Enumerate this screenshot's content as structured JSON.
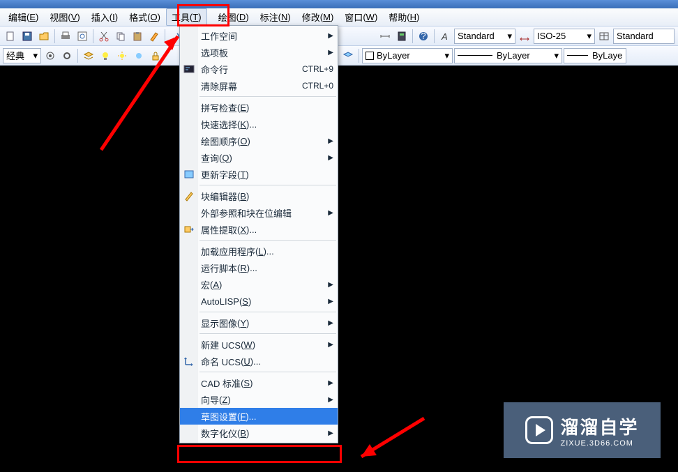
{
  "menubar": {
    "items": [
      {
        "label": "编辑",
        "key": "E"
      },
      {
        "label": "视图",
        "key": "V"
      },
      {
        "label": "插入",
        "key": "I"
      },
      {
        "label": "格式",
        "key": "O"
      },
      {
        "label": "工具",
        "key": "T"
      },
      {
        "label": "绘图",
        "key": "D"
      },
      {
        "label": "标注",
        "key": "N"
      },
      {
        "label": "修改",
        "key": "M"
      },
      {
        "label": "窗口",
        "key": "W"
      },
      {
        "label": "帮助",
        "key": "H"
      }
    ],
    "active_index": 4
  },
  "toolbar1": {
    "style_dropdown1": "Standard",
    "style_dropdown2": "ISO-25",
    "style_dropdown3": "Standard"
  },
  "toolbar2": {
    "workspace": "经典",
    "layer_dropdown": "ByLayer",
    "linetype_dropdown": "ByLayer",
    "lineweight_dropdown": "ByLaye"
  },
  "tools_menu": {
    "items": [
      {
        "label": "工作空间",
        "submenu": true
      },
      {
        "label": "选项板",
        "submenu": true
      },
      {
        "label": "命令行",
        "shortcut": "CTRL+9",
        "icon": "cmd"
      },
      {
        "label": "清除屏幕",
        "shortcut": "CTRL+0"
      },
      {
        "sep": true
      },
      {
        "label": "拼写检查",
        "key": "E"
      },
      {
        "label": "快速选择",
        "key": "K",
        "ellipsis": true
      },
      {
        "label": "绘图顺序",
        "key": "O",
        "submenu": true
      },
      {
        "label": "查询",
        "key": "Q",
        "submenu": true
      },
      {
        "label": "更新字段",
        "key": "T",
        "icon": "field"
      },
      {
        "sep": true
      },
      {
        "label": "块编辑器",
        "key": "B",
        "icon": "block"
      },
      {
        "label": "外部参照和块在位编辑",
        "submenu": true
      },
      {
        "label": "属性提取",
        "key": "X",
        "ellipsis": true,
        "icon": "attr"
      },
      {
        "sep": true
      },
      {
        "label": "加载应用程序",
        "key": "L",
        "ellipsis": true
      },
      {
        "label": "运行脚本",
        "key": "R",
        "ellipsis": true
      },
      {
        "label": "宏",
        "key": "A",
        "submenu": true
      },
      {
        "label": "AutoLISP",
        "key": "S",
        "submenu": true,
        "raw": true
      },
      {
        "sep": true
      },
      {
        "label": "显示图像",
        "key": "Y",
        "submenu": true
      },
      {
        "sep": true
      },
      {
        "label": "新建 UCS",
        "key": "W",
        "submenu": true
      },
      {
        "label": "命名 UCS",
        "key": "U",
        "ellipsis": true,
        "icon": "ucs"
      },
      {
        "sep": true
      },
      {
        "label": "CAD 标准",
        "key": "S",
        "submenu": true
      },
      {
        "label": "向导",
        "key": "Z",
        "submenu": true
      },
      {
        "label": "草图设置",
        "key": "F",
        "ellipsis": true,
        "selected": true
      },
      {
        "label": "数字化仪",
        "key": "B",
        "submenu": true
      }
    ]
  },
  "watermark": {
    "title": "溜溜自学",
    "url": "ZIXUE.3D66.COM"
  }
}
